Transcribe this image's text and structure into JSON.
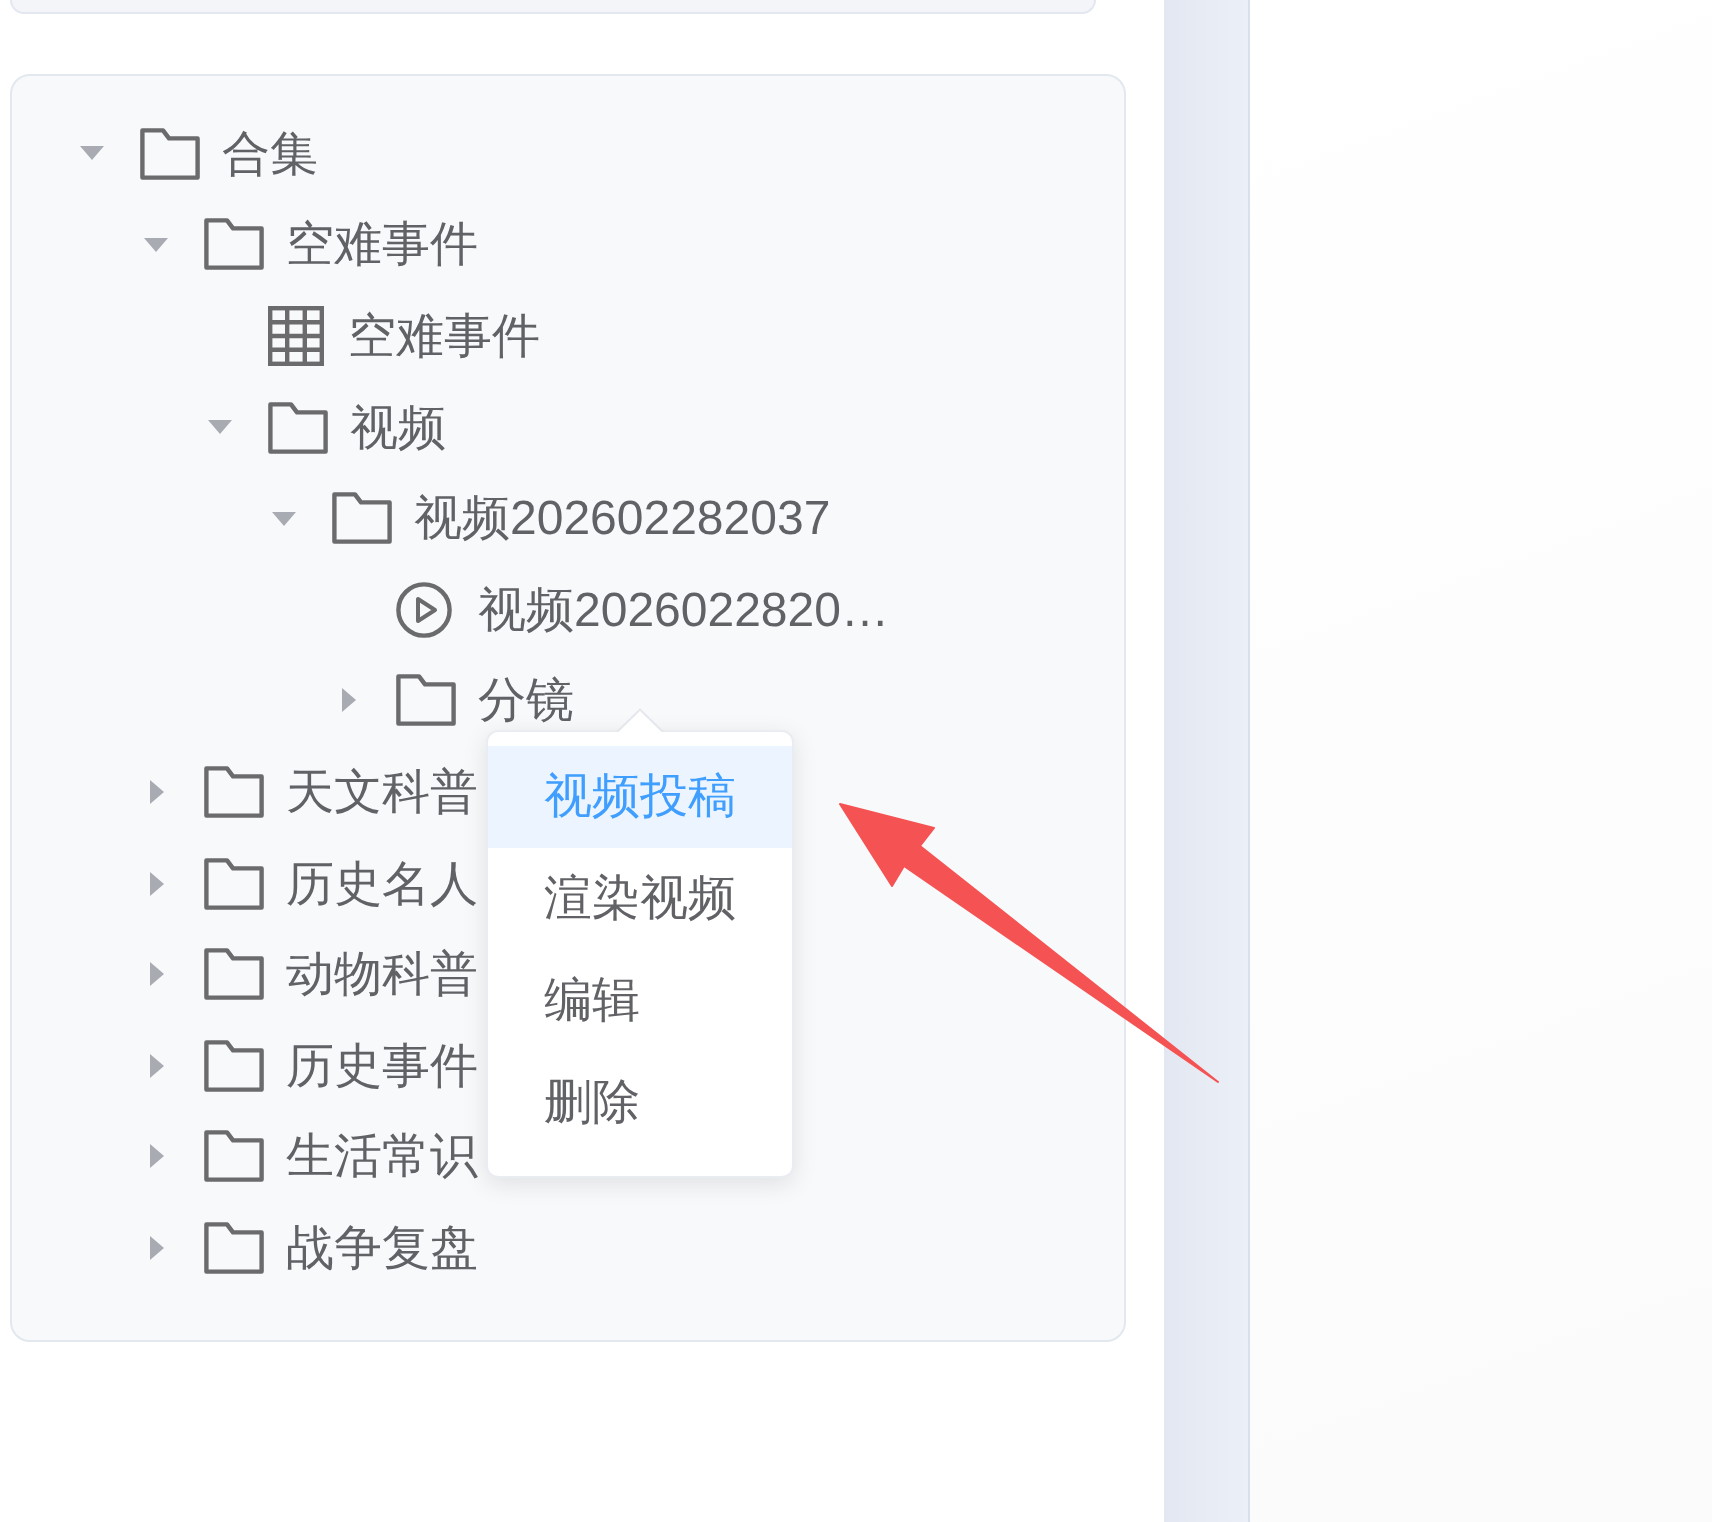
{
  "tree": [
    {
      "kind": "folder",
      "label": "合集",
      "expanded": true,
      "children": [
        {
          "kind": "folder",
          "label": "空难事件",
          "expanded": true,
          "children": [
            {
              "kind": "table",
              "label": "空难事件"
            },
            {
              "kind": "folder",
              "label": "视频",
              "expanded": true,
              "children": [
                {
                  "kind": "folder",
                  "label": "视频202602282037",
                  "expanded": true,
                  "children": [
                    {
                      "kind": "video",
                      "label": "视频2026022820…"
                    },
                    {
                      "kind": "folder",
                      "label": "分镜",
                      "expanded": false
                    }
                  ]
                }
              ]
            }
          ]
        },
        {
          "kind": "folder",
          "label": "天文科普",
          "expanded": false
        },
        {
          "kind": "folder",
          "label": "历史名人",
          "expanded": false
        },
        {
          "kind": "folder",
          "label": "动物科普",
          "expanded": false
        },
        {
          "kind": "folder",
          "label": "历史事件",
          "expanded": false
        },
        {
          "kind": "folder",
          "label": "生活常识",
          "expanded": false
        },
        {
          "kind": "folder",
          "label": "战争复盘",
          "expanded": false
        }
      ]
    }
  ],
  "context_menu": {
    "items": [
      {
        "label": "视频投稿",
        "selected": true
      },
      {
        "label": "渲染视频",
        "selected": false
      },
      {
        "label": "编辑",
        "selected": false
      },
      {
        "label": "删除",
        "selected": false
      }
    ]
  }
}
